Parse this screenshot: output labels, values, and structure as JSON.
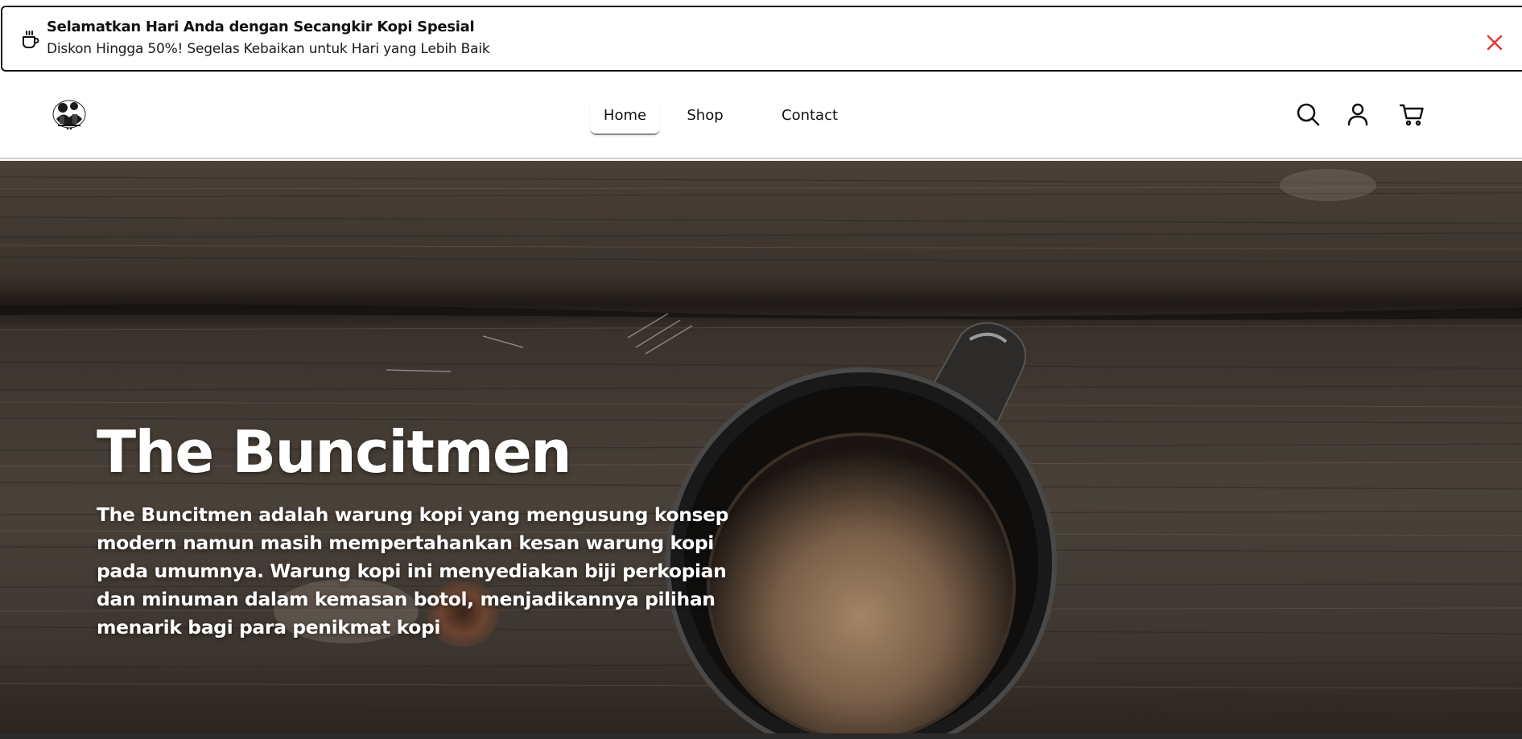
{
  "promo": {
    "title": "Selamatkan Hari Anda dengan Secangkir Kopi Spesial",
    "subtitle": "Diskon Hingga 50%! Segelas Kebaikan untuk Hari yang Lebih Baik",
    "icon": "coffee-cup-icon",
    "close_icon": "close-icon",
    "close_color": "#e53935"
  },
  "header": {
    "logo": "brand-logo",
    "nav": [
      {
        "label": "Home",
        "active": true
      },
      {
        "label": "Shop",
        "active": false
      },
      {
        "label": "Contact",
        "active": false
      }
    ],
    "icons": [
      "search-icon",
      "user-icon",
      "cart-icon"
    ]
  },
  "hero": {
    "title": "The Buncitmen",
    "description": "The Buncitmen adalah warung kopi yang mengusung konsep modern namun masih mempertahankan kesan warung kopi pada umumnya. Warung kopi ini menyediakan biji perkopian dan minuman dalam kemasan botol, menjadikannya pilihan menarik bagi para penikmat kopi"
  }
}
